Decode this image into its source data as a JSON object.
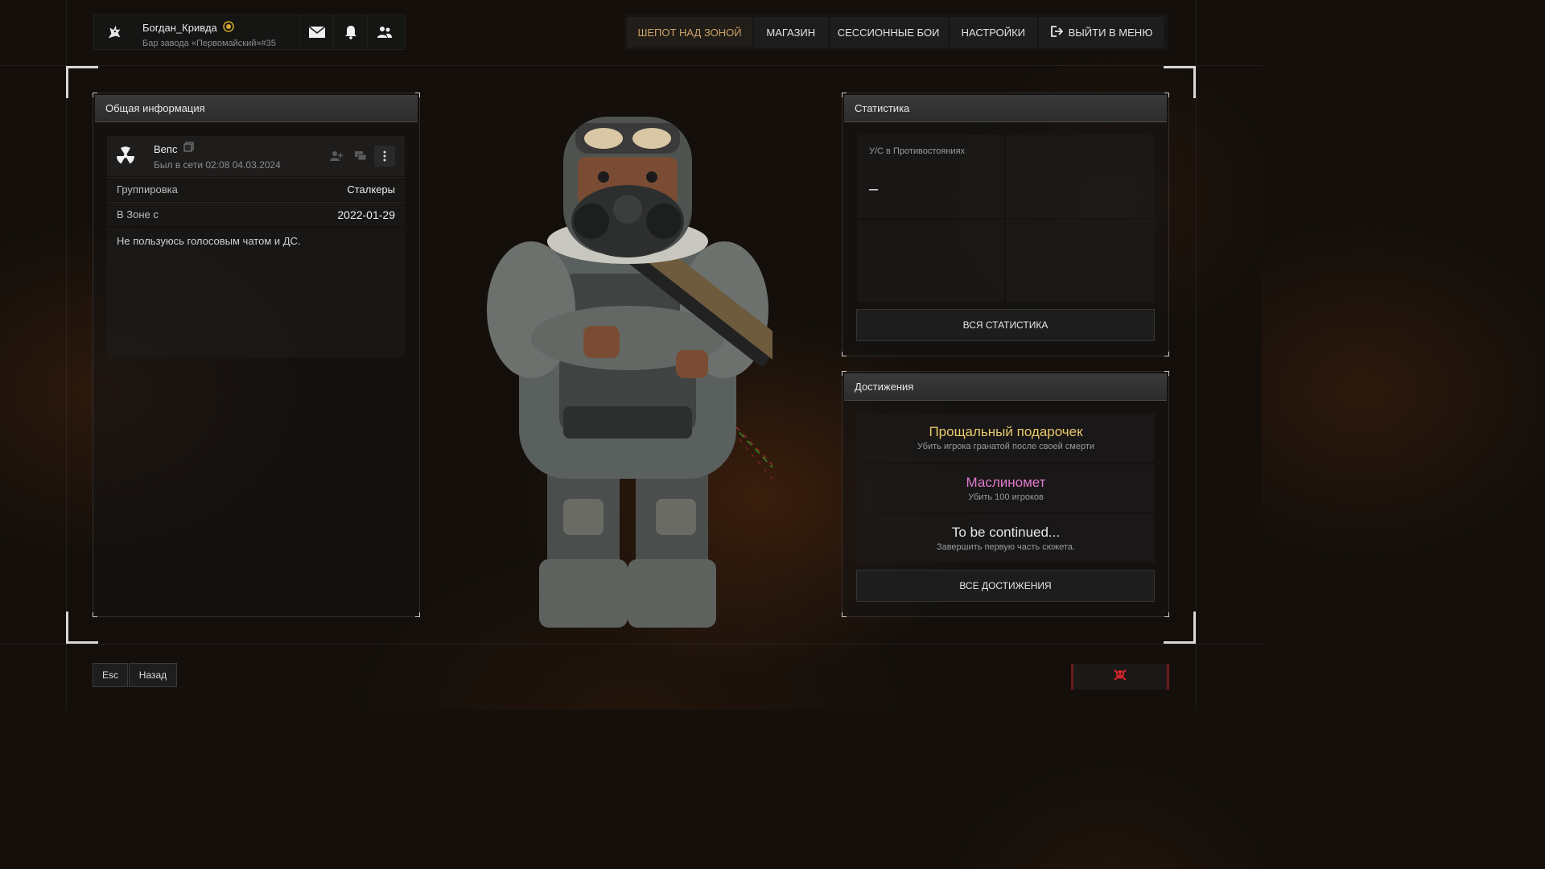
{
  "header": {
    "username": "Богдан_Кривда",
    "location": "Бар завода «Первомайский»#35",
    "icons": [
      "wolf-logo-icon",
      "badge-icon",
      "mail-icon",
      "bell-icon",
      "friends-icon"
    ]
  },
  "nav": {
    "items": [
      {
        "label": "ШЕПОТ НАД ЗОНОЙ",
        "active": true
      },
      {
        "label": "МАГАЗИН"
      },
      {
        "label": "СЕССИОННЫЕ БОИ"
      },
      {
        "label": "НАСТРОЙКИ"
      },
      {
        "label": "ВЫЙТИ В МЕНЮ",
        "icon": "exit-icon"
      }
    ]
  },
  "general": {
    "title": "Общая информация",
    "user": {
      "name": "Вепс",
      "last_seen": "Был в сети 02:08 04.03.2024",
      "icon": "radiation-icon"
    },
    "rows": [
      {
        "label": "Группировка",
        "value": "Сталкеры"
      },
      {
        "label": "В Зоне с",
        "value": "2022-01-29"
      }
    ],
    "about": "Не пользуюсь голосовым чатом и ДС."
  },
  "stats": {
    "title": "Статистика",
    "cell_label": "У/С в Противостояниях",
    "cell_value": "–",
    "button": "ВСЯ СТАТИСТИКА"
  },
  "achievements": {
    "title": "Достижения",
    "items": [
      {
        "title": "Прощальный подарочек",
        "desc": "Убить игрока гранатой после своей смерти",
        "color": "#e8c86a"
      },
      {
        "title": "Маслиномет",
        "desc": "Убить 100 игроков",
        "color": "#e07ad0"
      },
      {
        "title": "To be continued...",
        "desc": "Завершить первую часть сюжета.",
        "color": "#e8e8e8"
      }
    ],
    "button": "ВСЕ ДОСТИЖЕНИЯ"
  },
  "footer": {
    "esc": "Esc",
    "back": "Назад",
    "danger_icon": "skull-crossbones-icon"
  },
  "colors": {
    "accent": "#c9a368",
    "danger": "#d0252a"
  }
}
